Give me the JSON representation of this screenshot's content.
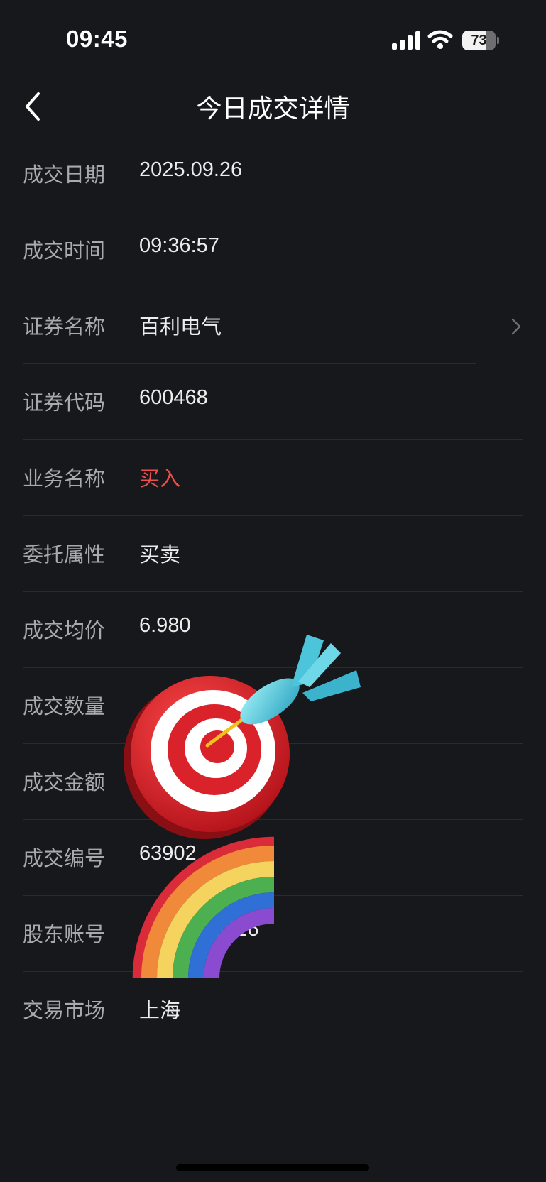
{
  "status_bar": {
    "time": "09:45",
    "battery": "73",
    "battery_level": 0.73
  },
  "nav": {
    "title": "今日成交详情"
  },
  "rows": [
    {
      "label": "成交日期",
      "value": "2025.09.26"
    },
    {
      "label": "成交时间",
      "value": "09:36:57"
    },
    {
      "label": "证券名称",
      "value": "百利电气"
    },
    {
      "label": "证券代码",
      "value": "600468"
    },
    {
      "label": "业务名称",
      "value": "买入"
    },
    {
      "label": "委托属性",
      "value": "买卖"
    },
    {
      "label": "成交均价",
      "value": "6.980"
    },
    {
      "label": "成交数量",
      "value": ""
    },
    {
      "label": "成交金额",
      "value": ""
    },
    {
      "label": "成交编号",
      "value": "63902"
    },
    {
      "label": "股东账号",
      "value": "3226"
    },
    {
      "label": "交易市场",
      "value": "上海"
    }
  ],
  "colors": {
    "background": "#17181b",
    "buy_red": "#ef4c4c",
    "label": "#a9a9ae",
    "value": "#ececec"
  },
  "icons": {
    "back": "chevron-left-icon",
    "disclosure": "chevron-right-icon",
    "sticker_1": "dart-target-sticker",
    "sticker_2": "rainbow-sticker"
  }
}
